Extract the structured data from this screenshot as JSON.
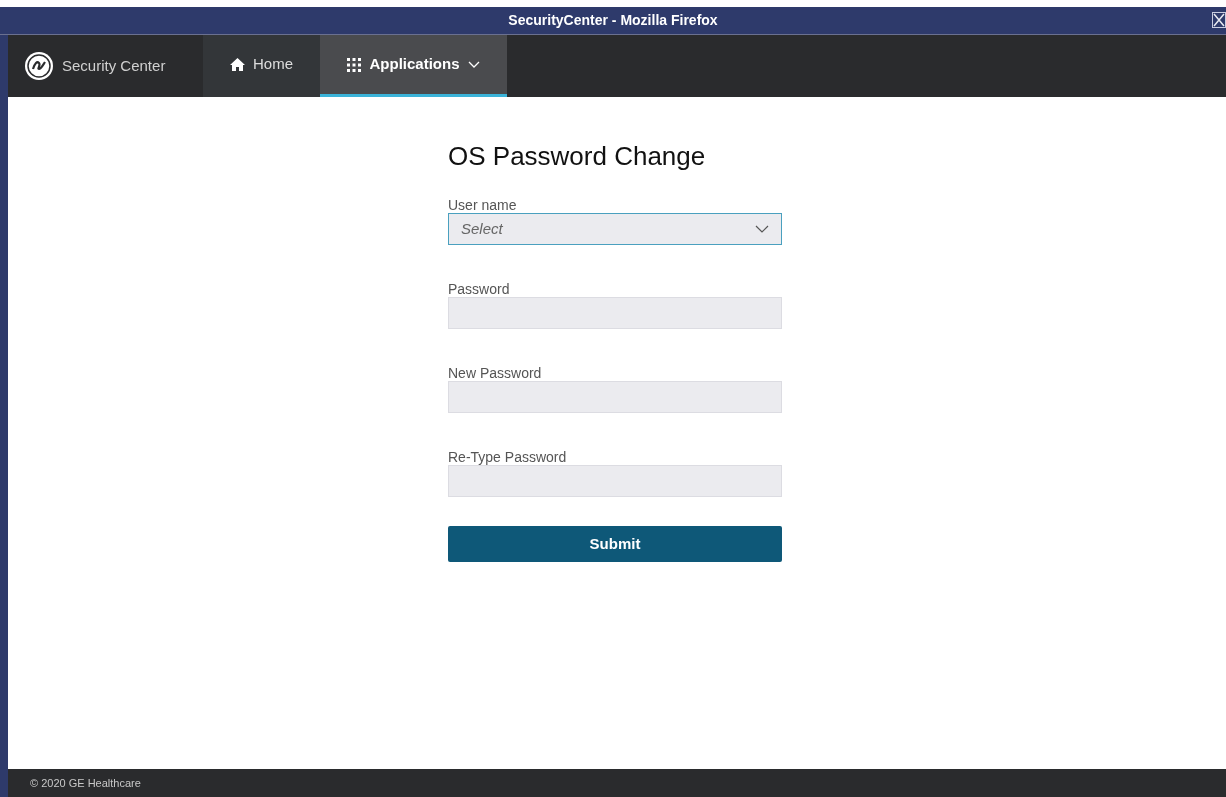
{
  "window": {
    "title": "SecurityCenter - Mozilla Firefox"
  },
  "nav": {
    "brand": "Security Center",
    "tabs": [
      {
        "label": "Home",
        "kind": "home",
        "selected": false,
        "has_menu": false
      },
      {
        "label": "Applications",
        "kind": "apps",
        "selected": true,
        "has_menu": true
      }
    ]
  },
  "form": {
    "title": "OS Password Change",
    "fields": [
      {
        "label": "User name",
        "kind": "select",
        "placeholder": "Select",
        "focused": true
      },
      {
        "label": "Password",
        "kind": "password",
        "focused": false
      },
      {
        "label": "New Password",
        "kind": "password",
        "focused": false
      },
      {
        "label": "Re-Type Password",
        "kind": "password",
        "focused": false
      }
    ],
    "submit": "Submit"
  },
  "footer": "© 2020 GE Healthcare"
}
